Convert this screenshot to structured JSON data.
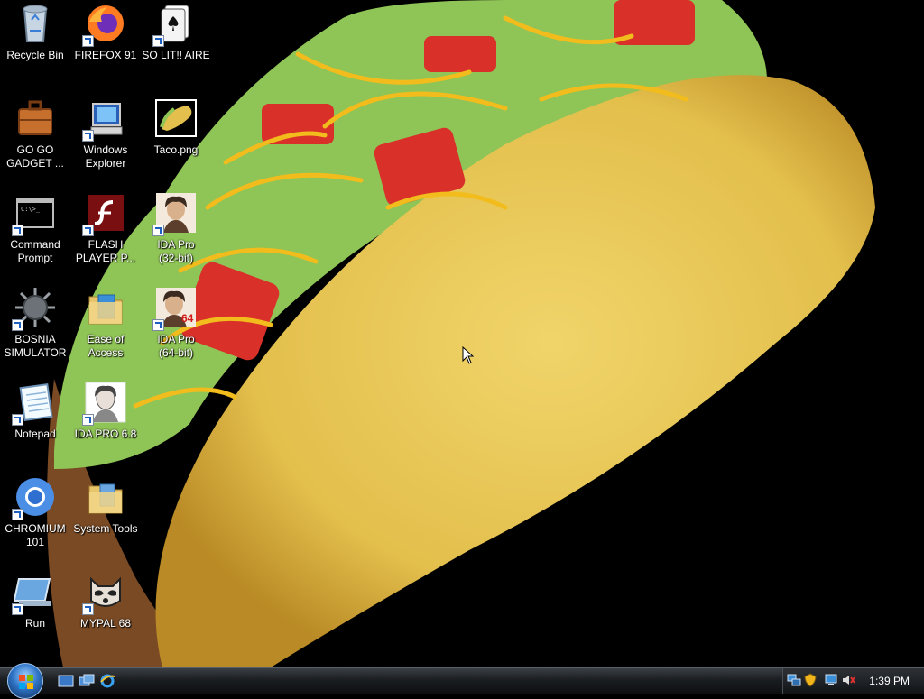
{
  "desktop": {
    "icons": [
      {
        "label": "Recycle Bin",
        "icon": "recycle-bin-icon"
      },
      {
        "label": "FIREFOX 91",
        "icon": "firefox-icon"
      },
      {
        "label": "SO LIT!! AIRE",
        "icon": "solitaire-icon"
      },
      {
        "label": "GO GO\nGADGET ...",
        "icon": "briefcase-icon"
      },
      {
        "label": "Windows\nExplorer",
        "icon": "windows-explorer-icon"
      },
      {
        "label": "Taco.png",
        "icon": "taco-image-icon"
      },
      {
        "label": "Command\nPrompt",
        "icon": "command-prompt-icon"
      },
      {
        "label": "FLASH\nPLAYER P...",
        "icon": "flash-player-icon"
      },
      {
        "label": "IDA Pro\n(32-bit)",
        "icon": "ida-pro-icon"
      },
      {
        "label": "BOSNIA\nSIMULATOR",
        "icon": "spiked-ball-icon"
      },
      {
        "label": "Ease of\nAccess",
        "icon": "folder-icon"
      },
      {
        "label": "IDA Pro\n(64-bit)",
        "icon": "ida-pro-64-icon"
      },
      {
        "label": "Notepad",
        "icon": "notepad-icon"
      },
      {
        "label": "IDA PRO 6.8",
        "icon": "ida-pro-icon"
      },
      {
        "label": "CHROMIUM\n101",
        "icon": "chromium-icon"
      },
      {
        "label": "System Tools",
        "icon": "folder-icon"
      },
      {
        "label": "Run",
        "icon": "run-icon"
      },
      {
        "label": "MYPAL 68",
        "icon": "mypal-raccoon-icon"
      }
    ]
  },
  "taskbar": {
    "start_button": "start-orb-icon",
    "quick_launch": [
      "show-desktop-icon",
      "switch-windows-icon",
      "internet-explorer-icon"
    ],
    "tray_icons": [
      "network-icon",
      "security-shield-icon",
      "monitor-icon",
      "volume-muted-icon"
    ],
    "clock": "1:39 PM"
  }
}
